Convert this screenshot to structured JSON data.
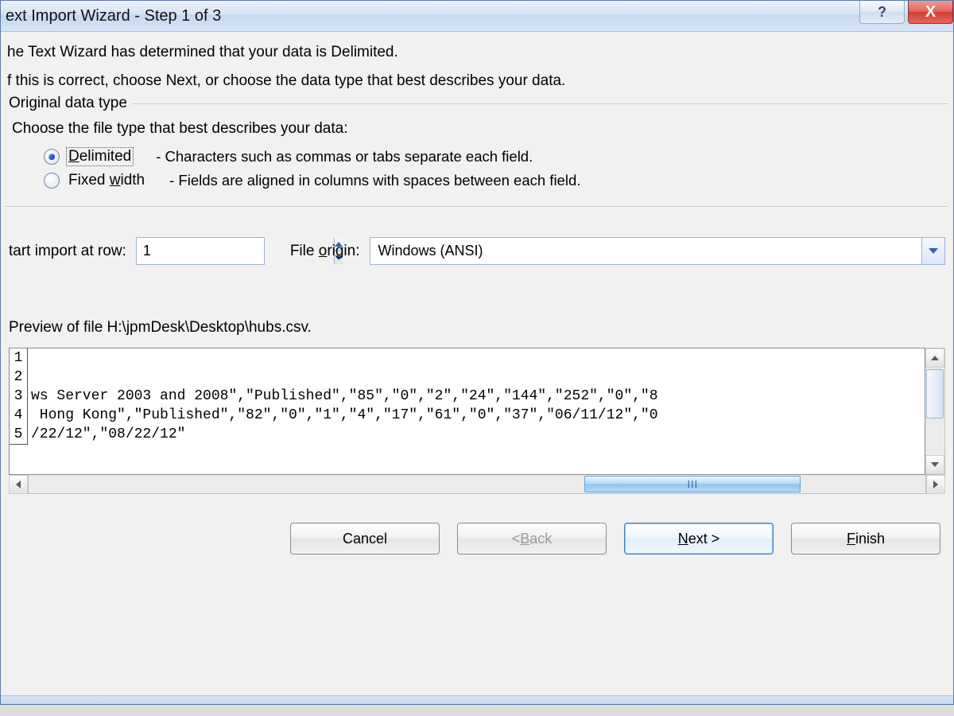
{
  "titlebar": {
    "title": "ext Import Wizard - Step 1 of 3",
    "help_tooltip": "?",
    "close_tooltip": "X"
  },
  "intro": {
    "line1": "he Text Wizard has determined that your data is Delimited.",
    "line2": "f this is correct, choose Next, or choose the data type that best describes your data."
  },
  "group": {
    "legend": "Original data type",
    "sub": "Choose the file type that best describes your data:",
    "options": {
      "delimited": {
        "prefix": "D",
        "rest": "elimited",
        "desc": "- Characters such as commas or tabs separate each field."
      },
      "fixed": {
        "full_pre": "Fixed ",
        "ul": "w",
        "full_post": "idth",
        "desc": "- Fields are aligned in columns with spaces between each field."
      }
    }
  },
  "row": {
    "start_label": "tart import at row:",
    "start_value": "1",
    "origin_pre": "File ",
    "origin_ul": "o",
    "origin_post": "rigin:",
    "origin_value": "Windows (ANSI)"
  },
  "preview": {
    "label": "Preview of file H:\\jpmDesk\\Desktop\\hubs.csv.",
    "lines": [
      {
        "n": "1",
        "t": ""
      },
      {
        "n": "2",
        "t": ""
      },
      {
        "n": "3",
        "t": "ws Server 2003 and 2008\",\"Published\",\"85\",\"0\",\"2\",\"24\",\"144\",\"252\",\"0\",\"8"
      },
      {
        "n": "4",
        "t": " Hong Kong\",\"Published\",\"82\",\"0\",\"1\",\"4\",\"17\",\"61\",\"0\",\"37\",\"06/11/12\",\"0"
      },
      {
        "n": "5",
        "t": "/22/12\",\"08/22/12\""
      }
    ],
    "thumb_grip": "III"
  },
  "footer": {
    "cancel": "Cancel",
    "back_pre": "< ",
    "back_ul": "B",
    "back_post": "ack",
    "next_ul": "N",
    "next_post": "ext >",
    "finish_ul": "F",
    "finish_post": "inish"
  }
}
